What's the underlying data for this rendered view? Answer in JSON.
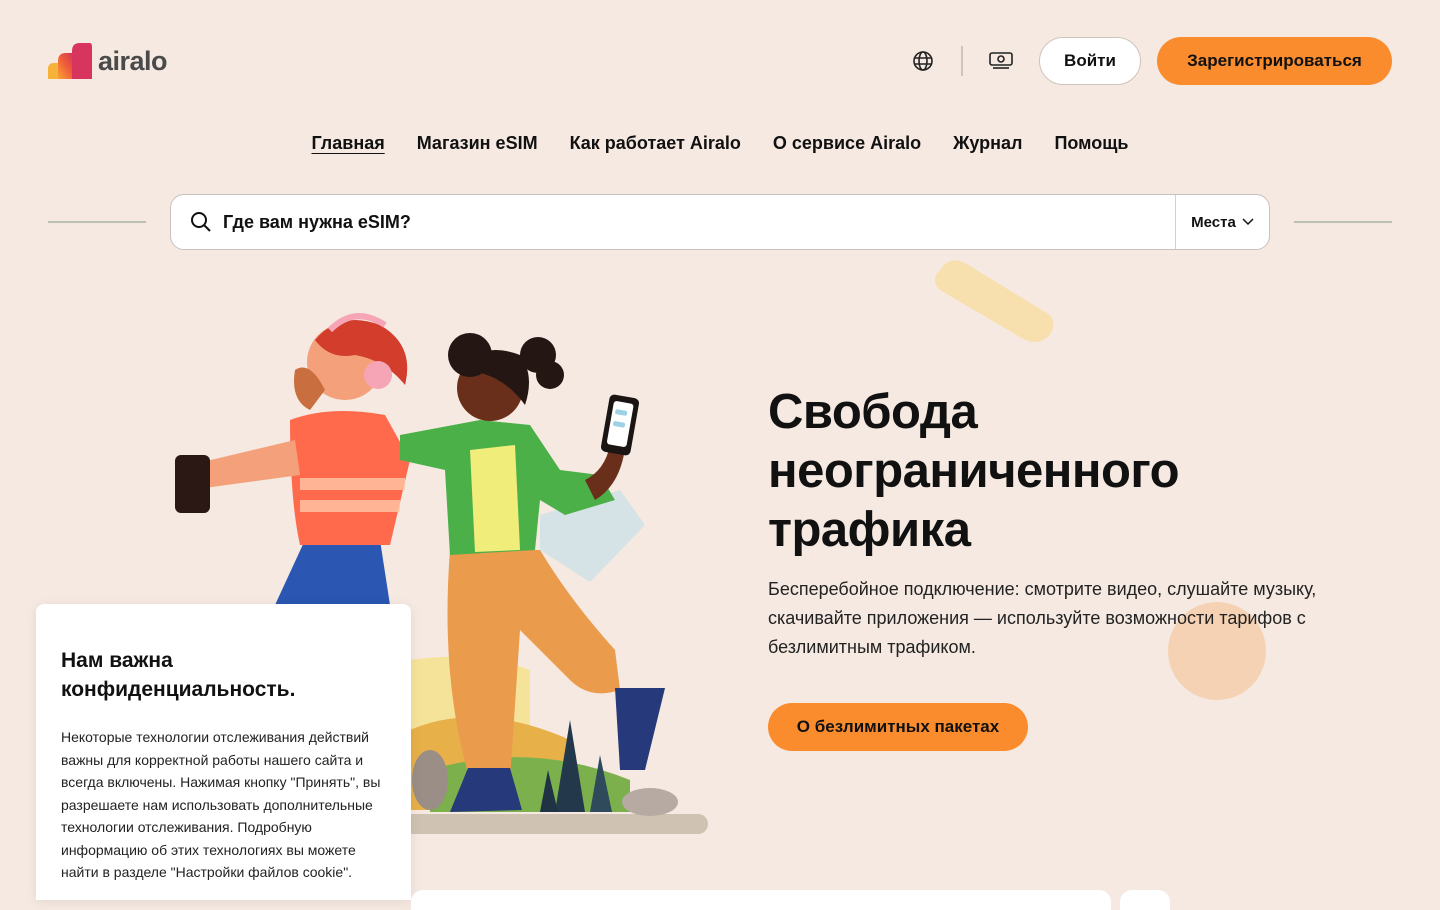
{
  "brand": {
    "name": "airalo"
  },
  "header": {
    "language_icon": "globe-icon",
    "currency_icon": "banknote-icon",
    "login_label": "Войти",
    "signup_label": "Зарегистрироваться"
  },
  "nav": {
    "items": [
      {
        "label": "Главная",
        "active": true
      },
      {
        "label": "Магазин eSIM",
        "active": false
      },
      {
        "label": "Как работает Airalo",
        "active": false
      },
      {
        "label": "О сервисе Airalo",
        "active": false
      },
      {
        "label": "Журнал",
        "active": false
      },
      {
        "label": "Помощь",
        "active": false
      }
    ]
  },
  "search": {
    "placeholder": "Где вам нужна eSIM?",
    "scope_label": "Места"
  },
  "hero": {
    "title_line1": "Свобода",
    "title_line2": "неограниченного",
    "title_line3": "трафика",
    "text": "Бесперебойное подключение: смотрите видео, слушайте музыку, скачивайте приложения — используйте возможности тарифов с безлимитным трафиком.",
    "cta_label": "О безлимитных пакетах"
  },
  "cookie": {
    "title": "Нам важна конфиденциальность.",
    "text": "Некоторые технологии отслеживания действий важны для корректной работы нашего сайта и всегда включены. Нажимая кнопку \"Принять\", вы разрешаете нам использовать дополнительные технологии отслеживания. Подробную информацию об этих технологиях вы можете найти в разделе \"Настройки файлов cookie\"."
  },
  "colors": {
    "background": "#f5e9e1",
    "accent": "#fa8c2e",
    "text": "#111111"
  }
}
